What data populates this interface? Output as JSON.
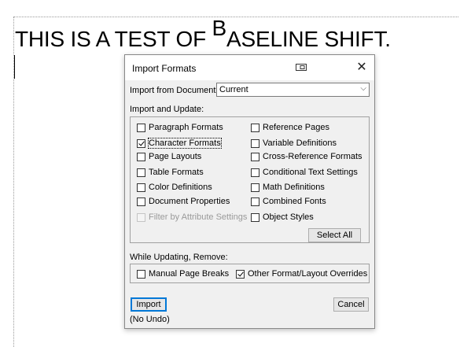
{
  "document": {
    "text_before": "THIS IS A TEST OF ",
    "text_shifted": "B",
    "text_after": "ASELINE SHIFT."
  },
  "dialog": {
    "title": "Import Formats",
    "import_from_label": "Import from Document:",
    "import_from_value": "Current",
    "import_update_label": "Import and Update:",
    "left_options": [
      {
        "label": "Paragraph Formats",
        "checked": false,
        "enabled": true
      },
      {
        "label": "Character Formats",
        "checked": true,
        "enabled": true
      },
      {
        "label": "Page Layouts",
        "checked": false,
        "enabled": true
      },
      {
        "label": "Table Formats",
        "checked": false,
        "enabled": true
      },
      {
        "label": "Color Definitions",
        "checked": false,
        "enabled": true
      },
      {
        "label": "Document Properties",
        "checked": false,
        "enabled": true
      },
      {
        "label": "Filter by Attribute Settings",
        "checked": false,
        "enabled": false
      }
    ],
    "right_options": [
      {
        "label": "Reference Pages",
        "checked": false,
        "enabled": true
      },
      {
        "label": "Variable Definitions",
        "checked": false,
        "enabled": true
      },
      {
        "label": "Cross-Reference Formats",
        "checked": false,
        "enabled": true
      },
      {
        "label": "Conditional Text Settings",
        "checked": false,
        "enabled": true
      },
      {
        "label": "Math Definitions",
        "checked": false,
        "enabled": true
      },
      {
        "label": "Combined Fonts",
        "checked": false,
        "enabled": true
      },
      {
        "label": "Object Styles",
        "checked": false,
        "enabled": true
      }
    ],
    "select_all_label": "Select All",
    "while_updating_label": "While Updating, Remove:",
    "remove_options": [
      {
        "label": "Manual Page Breaks",
        "checked": false
      },
      {
        "label": "Other Format/Layout Overrides",
        "checked": true
      }
    ],
    "import_button": "Import",
    "cancel_button": "Cancel",
    "no_undo": "(No Undo)"
  }
}
